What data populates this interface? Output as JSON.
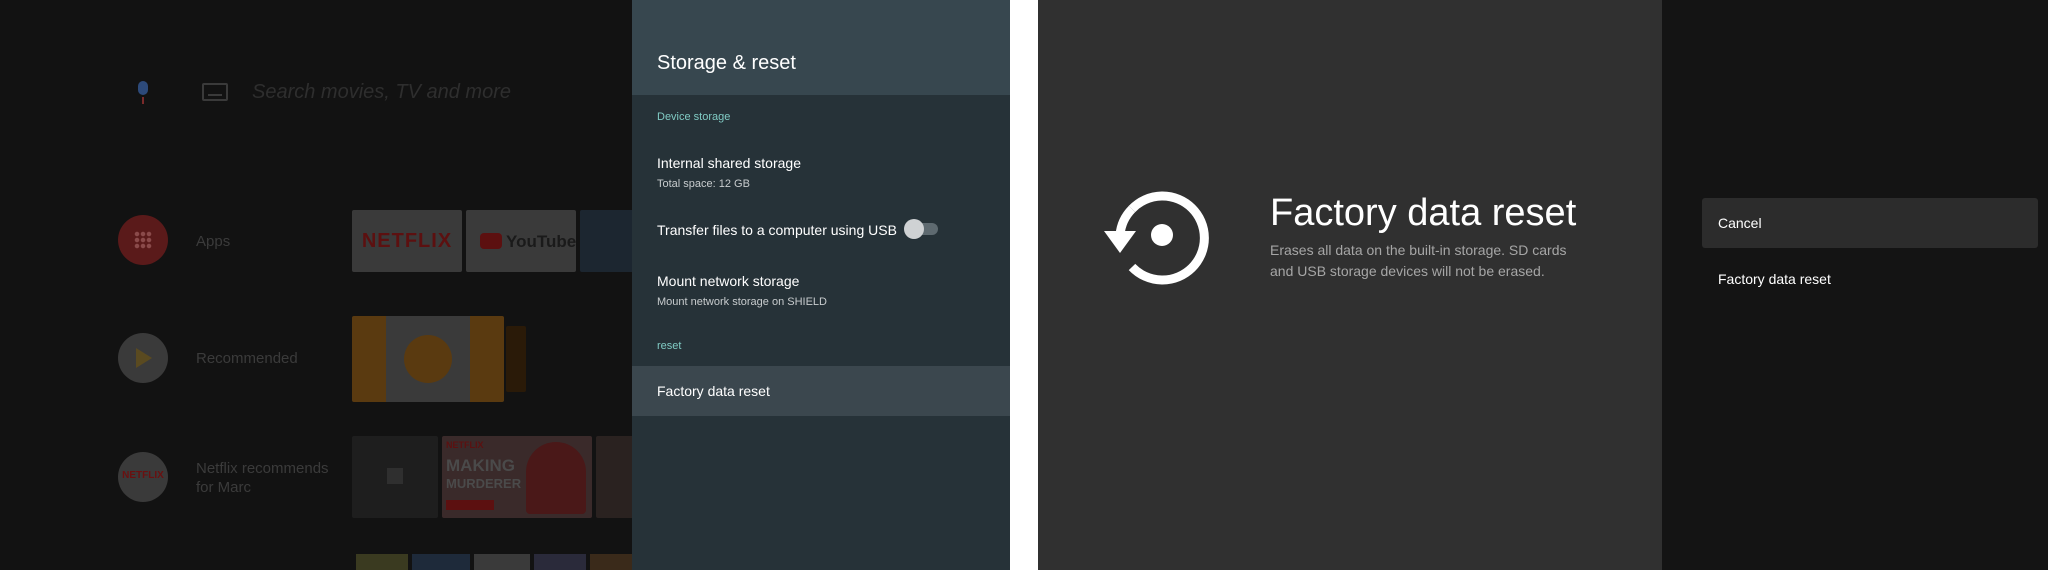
{
  "left": {
    "home": {
      "search_placeholder": "Search movies, TV and more",
      "rows": {
        "apps_label": "Apps",
        "recommended_label": "Recommended",
        "netflix_label": "Netflix recommends for Marc"
      },
      "tiles": {
        "netflix_logo": "NETFLIX",
        "youtube_logo": "YouTube",
        "netflix_icon_text": "NETFLIX",
        "show_brand": "NETFLIX",
        "show_title_line1": "MAKING",
        "show_title_line2": "MURDERER"
      }
    },
    "settings": {
      "title": "Storage & reset",
      "section_device_storage": "Device storage",
      "internal_storage_title": "Internal shared storage",
      "internal_storage_sub": "Total space: 12 GB",
      "usb_transfer_label": "Transfer files to a computer using USB",
      "usb_transfer_enabled": false,
      "mount_title": "Mount network storage",
      "mount_sub": "Mount network storage on SHIELD",
      "section_reset": "reset",
      "factory_reset_label": "Factory data reset"
    }
  },
  "right": {
    "title": "Factory data reset",
    "description": "Erases all data on the built-in storage. SD cards and USB storage devices will not be erased.",
    "options": {
      "cancel": "Cancel",
      "factory_reset": "Factory data reset"
    },
    "icon": "restore-icon"
  },
  "colors": {
    "panel_bg": "#263238",
    "panel_header": "#37474f",
    "category_accent": "#80cbc4",
    "selected_row": "#3b474e",
    "right_bg": "#303030",
    "options_bg": "#141414"
  }
}
